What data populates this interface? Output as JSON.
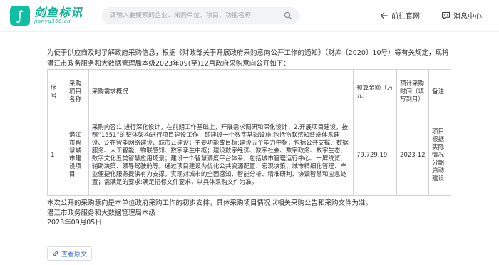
{
  "header": {
    "logo_mark": "∫",
    "logo_name": "剑鱼标讯",
    "logo_url": "jianyu360.cn",
    "search_placeholder": "请输入要搜索的企业、采购单位、项目、功能名称",
    "nav_official": "前往官网",
    "nav_messages": "消息中心"
  },
  "article": {
    "intro": "为便于供应商及时了解政府采购信息，根据《财政部关于开展政府采购意向公开工作的通知》（财库〔2020〕10号）等有关规定，现将潜江市政务服务和大数据管理局本级2023年09(至)12月政府采购意向公开如下：",
    "table": {
      "headers": [
        "序号",
        "采购项目名称",
        "采购需求概况",
        "预算金额（万元）",
        "预计采购时间（填写到月）",
        "备注"
      ],
      "rows": [
        {
          "no": "1",
          "name": "潜江市智慧城市建设项目",
          "description": "采购内容:1.进行深化设计，在前期工作基础上，开展需求调研和深化设计；2.开展项目建设，按照“1551”的整体架构进行项目建设工作，即建设一个数字基础设施,包括物联感知终端体系建设、泛在智能网络建设、城市云建设；主要功能或目标:建设五个能力中枢，包括公共支撑、数据服务、人工智能、物联感知、数字孪生中枢；建设数字经济、数字社会、数字政务、数字生态、数字文化五类智慧应用场景；建设一个智慧调度平台体系，包括城市管理运行中心、一屏统览、辅助决策、领导驾驶舱等。通过项目建设为优化公共资源配置、宏观决策、城市精细化管理、产业便捷化服务提供有力支撑，实现对城市的全面感知、智能分析、精准研判、协调智慧和应急处置；需满足的要求:满足招标文件要求，以具体采购文件为准。",
          "budget": "79,729.19",
          "time": "2023-12",
          "remark": "项目根据实际情况分期启动建设"
        }
      ]
    },
    "outro_line1": "本次公开的采购意向是本单位政府采购工作的初步安排，具体采购项目情况以相关采购公告和采购文件为准。",
    "outro_line2": "潜江市政务服务和大数据管理局本级",
    "outro_line3": "2023年09月05日",
    "view_original": "查看原文"
  },
  "colors": {
    "brand": "#12b394",
    "link": "#3b6fd6",
    "page_bg": "#f0f1f3"
  },
  "icons": [
    "logo-icon",
    "search-icon",
    "arrow-exit-icon",
    "chat-bubble-icon",
    "link-icon"
  ]
}
